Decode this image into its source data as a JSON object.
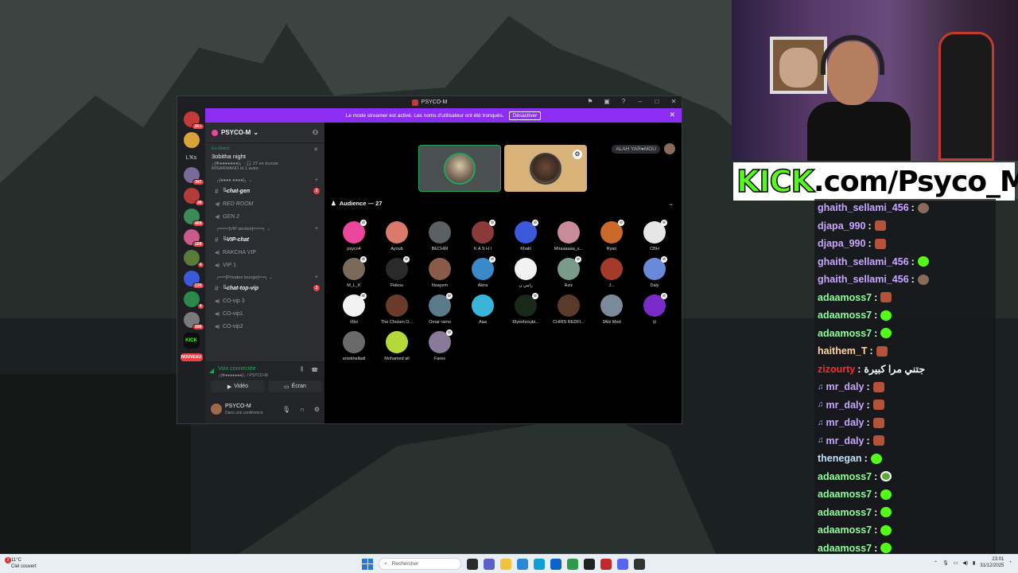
{
  "discord": {
    "title": "PSYCO-M",
    "banner": {
      "text": "Le mode streamer est activé. Les noms d'utilisateur ont été tronqués.",
      "button": "Désactiver"
    },
    "servers": [
      {
        "label": "",
        "badge": "1K+"
      },
      {
        "label": "",
        "badge": ""
      },
      {
        "label": "L'Ks",
        "badge": ""
      },
      {
        "label": "",
        "badge": "347"
      },
      {
        "label": "",
        "badge": "38"
      },
      {
        "label": "",
        "badge": "409"
      },
      {
        "label": "",
        "badge": "108"
      },
      {
        "label": "",
        "badge": "4"
      },
      {
        "label": "",
        "badge": "136"
      },
      {
        "label": "",
        "badge": "4"
      },
      {
        "label": "",
        "badge": "598"
      },
      {
        "label": "KICK",
        "badge": ""
      },
      {
        "label": "NOUVEAU",
        "badge": ""
      }
    ],
    "guild_name": "PSYCO-M",
    "event": {
      "live": "En Direct",
      "name": "3obitha night",
      "meta": "┌[✻●●●●●●●]┐ · 🎧 27 en écoute",
      "sub": "MISARWANO et 1 autre"
    },
    "categories": {
      "cat1": "┌[●●●● ●●●●]┐ ⌄",
      "cat2": "╒═══[VIP section]═══╕ ⌄",
      "cat3": "╒══[Privatee lounge]══╕ ⌄"
    },
    "channels": [
      {
        "name": "╚chat-gen",
        "unread": "1"
      },
      {
        "name": "RED ROOM"
      },
      {
        "name": "GEN 2"
      },
      {
        "name": "╚VIP-chat"
      },
      {
        "name": "RAKCHA VIP"
      },
      {
        "name": "VIP 1"
      },
      {
        "name": "╚chat-top-vip",
        "unread": "1"
      },
      {
        "name": "CO-vip 3"
      },
      {
        "name": "CO-vip1"
      },
      {
        "name": "CO-vip2"
      }
    ],
    "voice": {
      "status": "Voix connectée",
      "sub": "┌[✻●●●●●●●]┐ / PSYCO-M",
      "video": "Vidéo",
      "screen": "Écran"
    },
    "user": {
      "name": "PSYCO-M",
      "status": "Dans une conférence"
    },
    "host_tag": "ALAH YAR●MOU",
    "audience_title": "Audience — 27",
    "members": [
      {
        "name": "psyco4",
        "color": "#eb459e"
      },
      {
        "name": "Ayoub",
        "color": "#d97a6a"
      },
      {
        "name": "BECHIR",
        "color": "#5b5f66"
      },
      {
        "name": "K A S H I",
        "color": "#8a3a3a"
      },
      {
        "name": "Khalil",
        "color": "#3a5ad9"
      },
      {
        "name": "Miraaaaaa_s...",
        "color": "#c98a9a"
      },
      {
        "name": "Ryan",
        "color": "#c96a2a"
      },
      {
        "name": "CBH",
        "color": "#e6e6e6"
      },
      {
        "name": "M_L_K",
        "color": "#7a6a5a"
      },
      {
        "name": "Fkikou",
        "color": "#2a2a2a"
      },
      {
        "name": "Nsayem",
        "color": "#8a5a4a"
      },
      {
        "name": "Akira",
        "color": "#3a8ac9"
      },
      {
        "name": "ﺭﺍﻣﻲ ﻥ",
        "color": "#f2f2f2"
      },
      {
        "name": "Aziz",
        "color": "#7a9a8a"
      },
      {
        "name": "J...",
        "color": "#a33a2a"
      },
      {
        "name": "Daly",
        "color": "#6a8ad9"
      },
      {
        "name": "Vibo",
        "color": "#f2f2f2"
      },
      {
        "name": "The Chosen O...",
        "color": "#6a3a2a"
      },
      {
        "name": "Omar ramo",
        "color": "#5a7a8a"
      },
      {
        "name": "Aaa",
        "color": "#3ab5d9"
      },
      {
        "name": "Elyeshroubi...",
        "color": "#1a2a1a"
      },
      {
        "name": "CHRIS REDFI...",
        "color": "#5a3a2a"
      },
      {
        "name": "3Alé Med",
        "color": "#7a8a9a"
      },
      {
        "name": "iji",
        "color": "#7a2ac9"
      },
      {
        "name": "aniskhalladi",
        "color": "#6a6a6a"
      },
      {
        "name": "Mohamed ali",
        "color": "#b5d93a"
      },
      {
        "name": "Fares",
        "color": "#8a7a9a"
      }
    ]
  },
  "kick_banner": {
    "brand": "KICK",
    "rest": ".com/Psyco_M"
  },
  "chat": [
    {
      "user": "ghaith_sellami_456",
      "color": "#c9a6ff",
      "emote": "pic",
      "badge": "",
      "text": ""
    },
    {
      "user": "djapa_990",
      "color": "#c9a6ff",
      "emote": "red",
      "badge": "",
      "text": ""
    },
    {
      "user": "djapa_990",
      "color": "#c9a6ff",
      "emote": "red",
      "badge": "",
      "text": ""
    },
    {
      "user": "ghaith_sellami_456",
      "color": "#c9a6ff",
      "emote": "green",
      "badge": "",
      "text": ""
    },
    {
      "user": "ghaith_sellami_456",
      "color": "#c9a6ff",
      "emote": "pic",
      "badge": "",
      "text": ""
    },
    {
      "user": "adaamoss7",
      "color": "#8bff9a",
      "emote": "red",
      "badge": "",
      "text": ""
    },
    {
      "user": "adaamoss7",
      "color": "#8bff9a",
      "emote": "green",
      "badge": "",
      "text": ""
    },
    {
      "user": "adaamoss7",
      "color": "#8bff9a",
      "emote": "green",
      "badge": "",
      "text": ""
    },
    {
      "user": "haithem_T",
      "color": "#ffd6a6",
      "emote": "red",
      "badge": "",
      "text": ""
    },
    {
      "user": "zizourty",
      "color": "#ff2a2a",
      "emote": "",
      "badge": "",
      "text": "جتني مرا كبيرة"
    },
    {
      "user": "mr_daly",
      "color": "#c9a6ff",
      "emote": "red",
      "badge": "♫",
      "text": ""
    },
    {
      "user": "mr_daly",
      "color": "#c9a6ff",
      "emote": "red",
      "badge": "♫",
      "text": ""
    },
    {
      "user": "mr_daly",
      "color": "#c9a6ff",
      "emote": "red",
      "badge": "♫",
      "text": ""
    },
    {
      "user": "mr_daly",
      "color": "#c9a6ff",
      "emote": "red",
      "badge": "♫",
      "text": ""
    },
    {
      "user": "thenegan",
      "color": "#bfe3ff",
      "emote": "green",
      "badge": "",
      "text": ""
    },
    {
      "user": "adaamoss7",
      "color": "#8bff9a",
      "emote": "frog",
      "badge": "",
      "text": ""
    },
    {
      "user": "adaamoss7",
      "color": "#8bff9a",
      "emote": "green",
      "badge": "",
      "text": ""
    },
    {
      "user": "adaamoss7",
      "color": "#8bff9a",
      "emote": "green",
      "badge": "",
      "text": ""
    },
    {
      "user": "adaamoss7",
      "color": "#8bff9a",
      "emote": "green",
      "badge": "",
      "text": ""
    },
    {
      "user": "adaamoss7",
      "color": "#8bff9a",
      "emote": "green",
      "badge": "",
      "text": ""
    }
  ],
  "taskbar": {
    "weather_badge": "2",
    "weather_temp": "11°C",
    "weather_desc": "Ciel couvert",
    "search_placeholder": "Rechercher",
    "time": "23:01",
    "date": "31/12/2025",
    "apps": [
      {
        "name": "task-view",
        "color": "#2b2b2b"
      },
      {
        "name": "teams",
        "color": "#5b5fc7"
      },
      {
        "name": "file-explorer",
        "color": "#f2c23a"
      },
      {
        "name": "store",
        "color": "#2b88d8"
      },
      {
        "name": "edge",
        "color": "#0f9ed5"
      },
      {
        "name": "mail",
        "color": "#0a64c8"
      },
      {
        "name": "chrome",
        "color": "#2e9a4a"
      },
      {
        "name": "obs",
        "color": "#222"
      },
      {
        "name": "discord-red",
        "color": "#c22a2a"
      },
      {
        "name": "discord",
        "color": "#5865f2"
      },
      {
        "name": "epic",
        "color": "#333"
      }
    ]
  }
}
